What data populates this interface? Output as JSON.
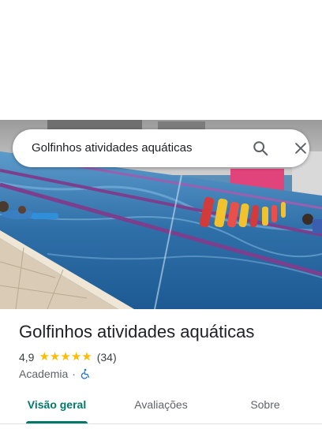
{
  "search": {
    "query": "Golfinhos atividades aquáticas",
    "search_icon": "search-icon",
    "close_icon": "close-icon"
  },
  "hero": {
    "photo": "indoor swimming pool with lane ropes and swimmers"
  },
  "place": {
    "name": "Golfinhos atividades aquáticas",
    "rating": "4,9",
    "rating_value": 4.9,
    "stars_max": 5,
    "star_glyph": "★",
    "review_count": "(34)",
    "category": "Academia",
    "separator": "·",
    "accessibility_icon": "wheelchair-icon"
  },
  "tabs": [
    {
      "label": "Visão geral",
      "active": true
    },
    {
      "label": "Avaliações",
      "active": false
    },
    {
      "label": "Sobre",
      "active": false
    }
  ],
  "colors": {
    "accent": "#00796b",
    "star": "#fbbc04",
    "access_icon": "#1a73e8"
  }
}
